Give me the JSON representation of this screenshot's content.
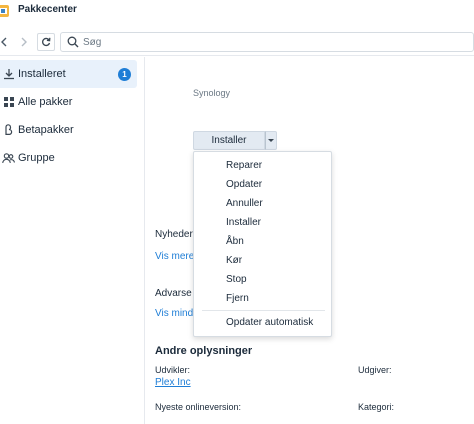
{
  "app": {
    "title": "Pakkecenter"
  },
  "toolbar": {
    "search_placeholder": "Søg"
  },
  "sidebar": {
    "items": [
      {
        "label": "Installeret",
        "icon": "download-icon",
        "badge": "1",
        "active": true
      },
      {
        "label": "Alle pakker",
        "icon": "grid-icon"
      },
      {
        "label": "Betapakker",
        "icon": "beta-icon"
      },
      {
        "label": "Gruppe",
        "icon": "group-icon"
      }
    ]
  },
  "main": {
    "vendor": "Synology",
    "install_button": "Installer",
    "news_heading": "Nyheder",
    "news_link": "Vis mere",
    "warnings_heading": "Advarse",
    "warnings_link": "Vis mind",
    "other_info_heading": "Andre oplysninger",
    "developer_label": "Udvikler:",
    "developer_value": "Plex Inc",
    "publisher_label": "Udgiver:",
    "latest_version_label": "Nyeste onlineversion:",
    "category_label": "Kategori:"
  },
  "menu": {
    "items": [
      "Reparer",
      "Opdater",
      "Annuller",
      "Installer",
      "Åbn",
      "Kør",
      "Stop",
      "Fjern"
    ],
    "footer_item": "Opdater automatisk"
  },
  "colors": {
    "accent": "#1f7ed6",
    "active_bg": "#e8f1fb"
  }
}
